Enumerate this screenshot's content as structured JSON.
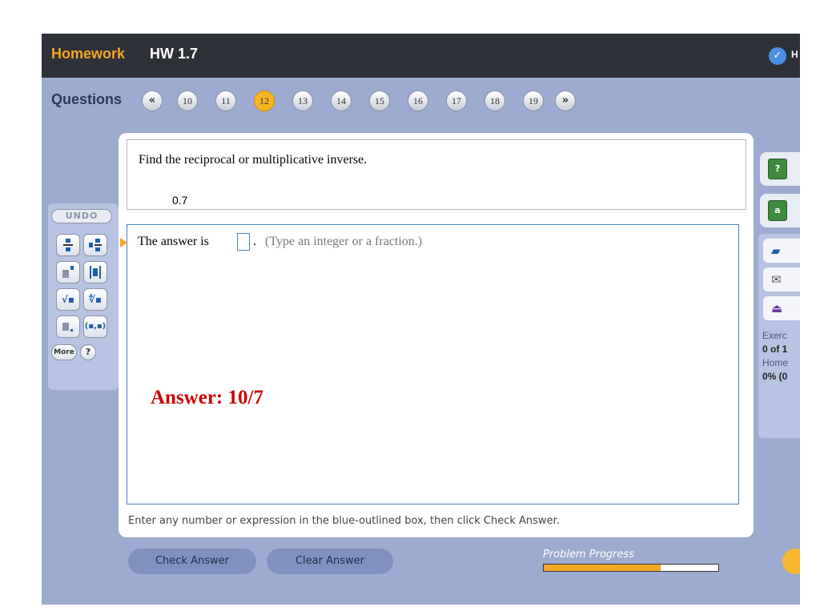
{
  "header": {
    "section_label": "Homework",
    "assignment_name": "HW 1.7",
    "right_text_cut": "H"
  },
  "questions": {
    "label": "Questions",
    "prev_glyph": "«",
    "next_glyph": "»",
    "numbers": [
      "10",
      "11",
      "12",
      "13",
      "14",
      "15",
      "16",
      "17",
      "18",
      "19"
    ],
    "current": "12"
  },
  "palette": {
    "undo_label": "UNDO",
    "more_label": "More",
    "help_label": "?"
  },
  "problem": {
    "instruction": "Find the reciprocal or multiplicative inverse.",
    "value": "0.7",
    "answer_prefix": "The answer is",
    "answer_value": "",
    "answer_suffix": ".",
    "answer_hint": "(Type an integer or a fraction.)",
    "annotation": "Answer: 10/7",
    "footer_hint": "Enter any number or expression in the blue-outlined box, then click Check Answer."
  },
  "actions": {
    "check_label": "Check Answer",
    "clear_label": "Clear Answer",
    "progress_label": "Problem Progress",
    "progress_fraction": 0.67
  },
  "sidebar": {
    "exercise_label_cut": "Exerc",
    "exercise_value_cut": "0 of 1",
    "homework_label_cut": "Home",
    "homework_value_cut": "0% (0"
  },
  "colors": {
    "accent": "#f5a623",
    "header_bg": "#2f3138",
    "app_bg": "#9cabcf",
    "answer_red": "#cc0000",
    "input_border": "#4a7fc0"
  }
}
